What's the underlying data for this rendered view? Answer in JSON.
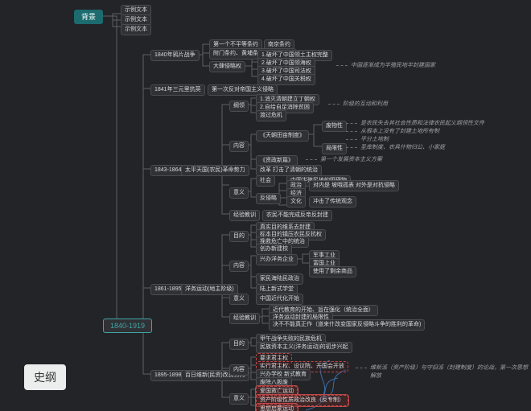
{
  "badge": "史纲",
  "root": "背景",
  "era": "1840-1919",
  "sample_text": [
    "示例文本",
    "示例文本",
    "示例文本"
  ],
  "opium": {
    "year": "1840年鸦片战争",
    "treaty": [
      "第一个不平等条约",
      "南京条约"
    ],
    "supp": "附门条约、黄埔条约、望厦条约",
    "sub": "大肆侵略权",
    "items": [
      "1.破坏了中国领土主权完整",
      "2.破坏了中国领海权",
      "3.破坏了中国司法权",
      "4.破坏了中国关税权"
    ],
    "note": "中国逐渐成为半殖民地半封建国家"
  },
  "rebel_1841": {
    "year": "1841年三元里抗英",
    "desc": "第一次反对帝国主义侵略"
  },
  "taiping": {
    "year": "1843-1864",
    "title": "太平天国(农民)革命势力",
    "aim": {
      "label": "纲领",
      "items": [
        "1.消灭清朝建立丁朝权",
        "2.自给自足消除贫困",
        "渡过危机"
      ],
      "note": "阶级的互动和利用"
    },
    "tian": {
      "label": "《天朝田亩制度》",
      "notes": [
        "是农民失去其社会性质和法律农民起义纲领性文件",
        "从根本上没有了封建土地所有制",
        "平分土地制",
        "圣库制度、农具什物归公、小家庭"
      ],
      "sub": [
        "废物性",
        "局限性"
      ]
    },
    "zixin": {
      "label": "《资政新篇》",
      "note": "第一个发展资本主义方案"
    },
    "gaige": "改革 打击了清朝的统治",
    "yiyi": {
      "label": "意义",
      "items": [
        [
          "社会",
          "中国半殖民地的阻碍物"
        ],
        [
          "政治",
          "对内是 坡哦孤表 对外是对抗侵略"
        ],
        [
          "经济",
          ""
        ],
        [
          "文化",
          "冲击了传统观念"
        ]
      ]
    },
    "lesson": {
      "label": "经验教训",
      "text": "农民不能完成反帝反封建"
    }
  },
  "yangwu": {
    "year": "1861-1895",
    "title": "洋务运动(地主阶级)",
    "aim": {
      "label": "目的",
      "items": [
        "真实目的维系去封建",
        "标本目的镇压农民反抗权",
        "挽救危亡中的统治"
      ]
    },
    "content": [
      "兴办洋务企业",
      "军事工业",
      "富国上业",
      "使用了剩余商品",
      "创办新建校"
    ],
    "sub": [
      "家民海陆民政治",
      "陆上新式学堂"
    ],
    "yiyi": {
      "label": "意义",
      "text": "中国近代化开始"
    },
    "lesson": {
      "label": "经验教训",
      "items": [
        "近代教育的开始、旨在强化（统治全面）",
        "洋务运动封建的局限性",
        "决不不能真正作（道来什改变国家反侵略斗争的胜利的革命)"
      ]
    }
  },
  "wuxu": {
    "year": "1895-1898",
    "title": "百日维新(民资)改良势力",
    "aim": {
      "label": "目的",
      "items": [
        "甲午战争失败的民族危机",
        "民族资本主义(洋务运动)的初步兴起"
      ]
    },
    "content": {
      "label": "内容",
      "items": [
        "要求君主权",
        "实行君主权、设议院、开国会开放",
        "兴办学校 新式教育",
        "废除八股废"
      ]
    },
    "note": "维新派（资产阶级）与守旧派（封建制度）的论战，第一次思想解放",
    "yiyi": {
      "label": "意义",
      "items": [
        "爱国救亡运动",
        "资产阶级性质政治改良（反专制）",
        "思想启蒙运动"
      ]
    }
  }
}
